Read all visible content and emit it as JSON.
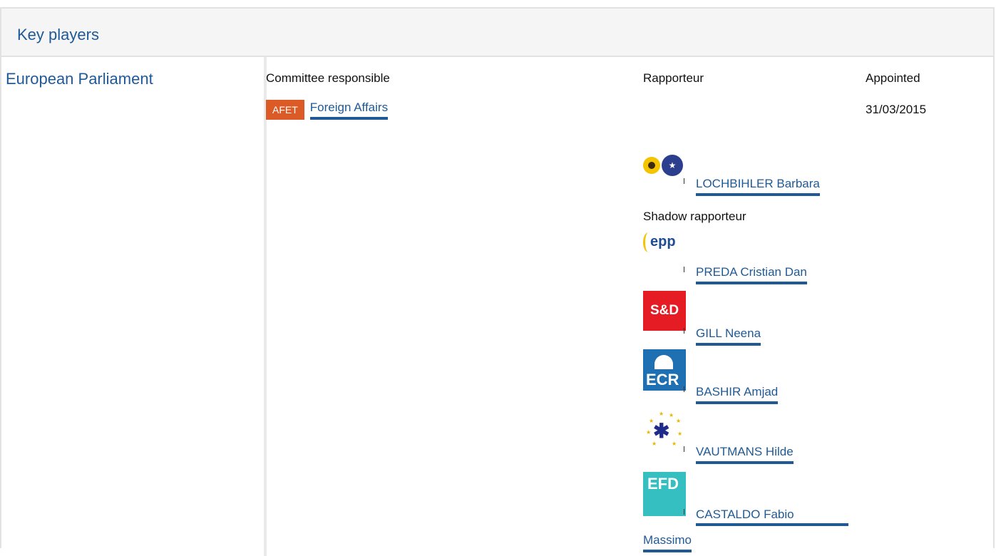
{
  "section": {
    "title": "Key players"
  },
  "institution": "European Parliament",
  "columns": {
    "committee": "Committee responsible",
    "rapporteur": "Rapporteur",
    "appointed": "Appointed"
  },
  "committee": {
    "code": "AFET",
    "name": "Foreign Affairs",
    "appointed": "31/03/2015"
  },
  "rapporteur": {
    "name": "LOCHBIHLER Barbara",
    "group_logo": "greens-efa-logo"
  },
  "shadow_label": "Shadow rapporteur",
  "shadows": [
    {
      "name": "PREDA Cristian Dan",
      "group_logo": "epp-logo",
      "logo_text": "epp"
    },
    {
      "name": "GILL Neena",
      "group_logo": "s-and-d-logo",
      "logo_text": "S&D"
    },
    {
      "name": "BASHIR Amjad",
      "group_logo": "ecr-logo",
      "logo_text": "ECR"
    },
    {
      "name": "VAUTMANS Hilde",
      "group_logo": "alde-logo"
    },
    {
      "name_line1": "CASTALDO Fabio",
      "name_line2": "Massimo",
      "group_logo": "efdd-logo",
      "logo_text": "EFD"
    }
  ],
  "colors": {
    "link": "#1f5a96",
    "badge": "#dc5a26"
  }
}
